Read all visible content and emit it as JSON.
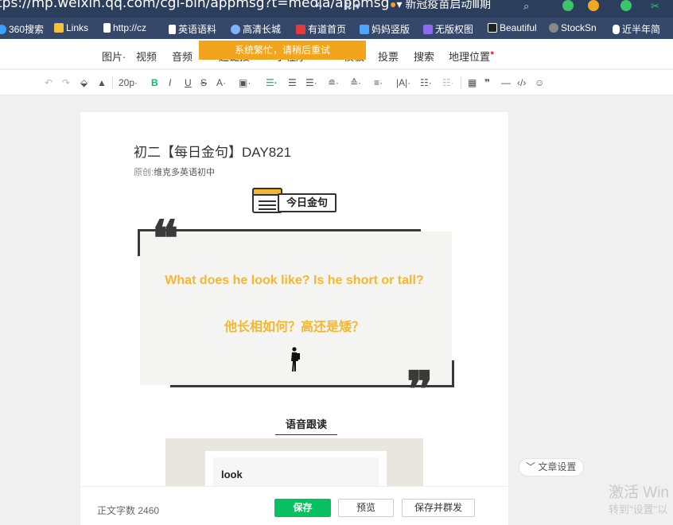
{
  "browser": {
    "url": "tps://mp.weixin.qq.com/cgi-bin/appmsg?t=media/appmsg",
    "news": "新冠疫苗启动Ⅲ期"
  },
  "bookmarks": [
    {
      "label": "360搜索",
      "color": "#3aa3ff"
    },
    {
      "label": "Links",
      "color": "#f3c13a"
    },
    {
      "label": "http://cz",
      "color": "#ffffff"
    },
    {
      "label": "英语语料",
      "color": "#ffffff"
    },
    {
      "label": "高清长城",
      "color": "#7fb3ff"
    },
    {
      "label": "有道首页",
      "color": "#e33b3b"
    },
    {
      "label": "妈妈竖版",
      "color": "#4ea3ff"
    },
    {
      "label": "无版权图",
      "color": "#8b6cf0"
    },
    {
      "label": "Beautiful",
      "color": "#222222"
    },
    {
      "label": "StockSn",
      "color": "#888888"
    },
    {
      "label": "近半年简",
      "color": "#ffffff"
    }
  ],
  "menu": {
    "items": [
      "图片",
      "视频",
      "音频",
      "超链接",
      "小程序",
      "模板",
      "投票",
      "搜索",
      "地理位置"
    ],
    "toast": "系统繁忙，请稍后重试"
  },
  "toolbar": {
    "font_size": "20p",
    "bold": "B",
    "italic": "I",
    "underline": "U",
    "strike": "S",
    "font_color": "A",
    "quote": "❞"
  },
  "article": {
    "title": "初二【每日金句】DAY821",
    "meta_label": "原创:",
    "author": "维克多英语初中",
    "badge": "今日金句",
    "quote_en": "What does he look like? Is he short or tall?",
    "quote_zh": "他长相如何？高还是矮？",
    "section_title": "语音跟读",
    "vocab_word": "look"
  },
  "footer": {
    "wordcount_label": "正文字数",
    "wordcount": "2460",
    "save": "保存",
    "preview": "预览",
    "publish": "保存并群发"
  },
  "settings_label": "文章设置",
  "watermark": {
    "line1": "激活 Win",
    "line2": "转到\"设置\"以"
  }
}
